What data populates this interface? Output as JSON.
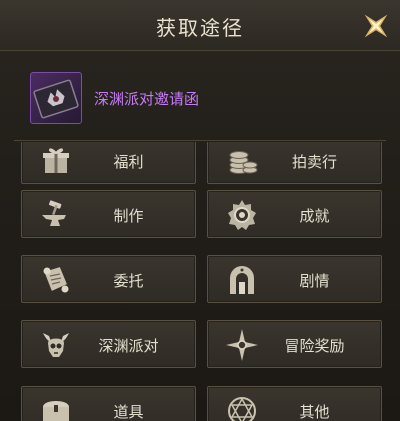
{
  "window": {
    "title": "获取途径",
    "close_icon": "close-x-star-icon"
  },
  "item": {
    "name": "深渊派对邀请函",
    "name_color": "#c57cf5",
    "icon": "invitation-card-icon"
  },
  "sources": [
    {
      "label": "福利",
      "icon": "gift-box-icon"
    },
    {
      "label": "拍卖行",
      "icon": "coin-stack-icon"
    },
    {
      "label": "制作",
      "icon": "anvil-hammer-icon"
    },
    {
      "label": "成就",
      "icon": "medal-badge-icon"
    },
    {
      "label": "委托",
      "icon": "scroll-icon"
    },
    {
      "label": "剧情",
      "icon": "archway-gate-icon"
    },
    {
      "label": "深渊派对",
      "icon": "horned-skull-icon"
    },
    {
      "label": "冒险奖励",
      "icon": "compass-star-icon"
    },
    {
      "label": "道具",
      "icon": "treasure-chest-icon"
    },
    {
      "label": "其他",
      "icon": "magic-circle-icon"
    }
  ]
}
